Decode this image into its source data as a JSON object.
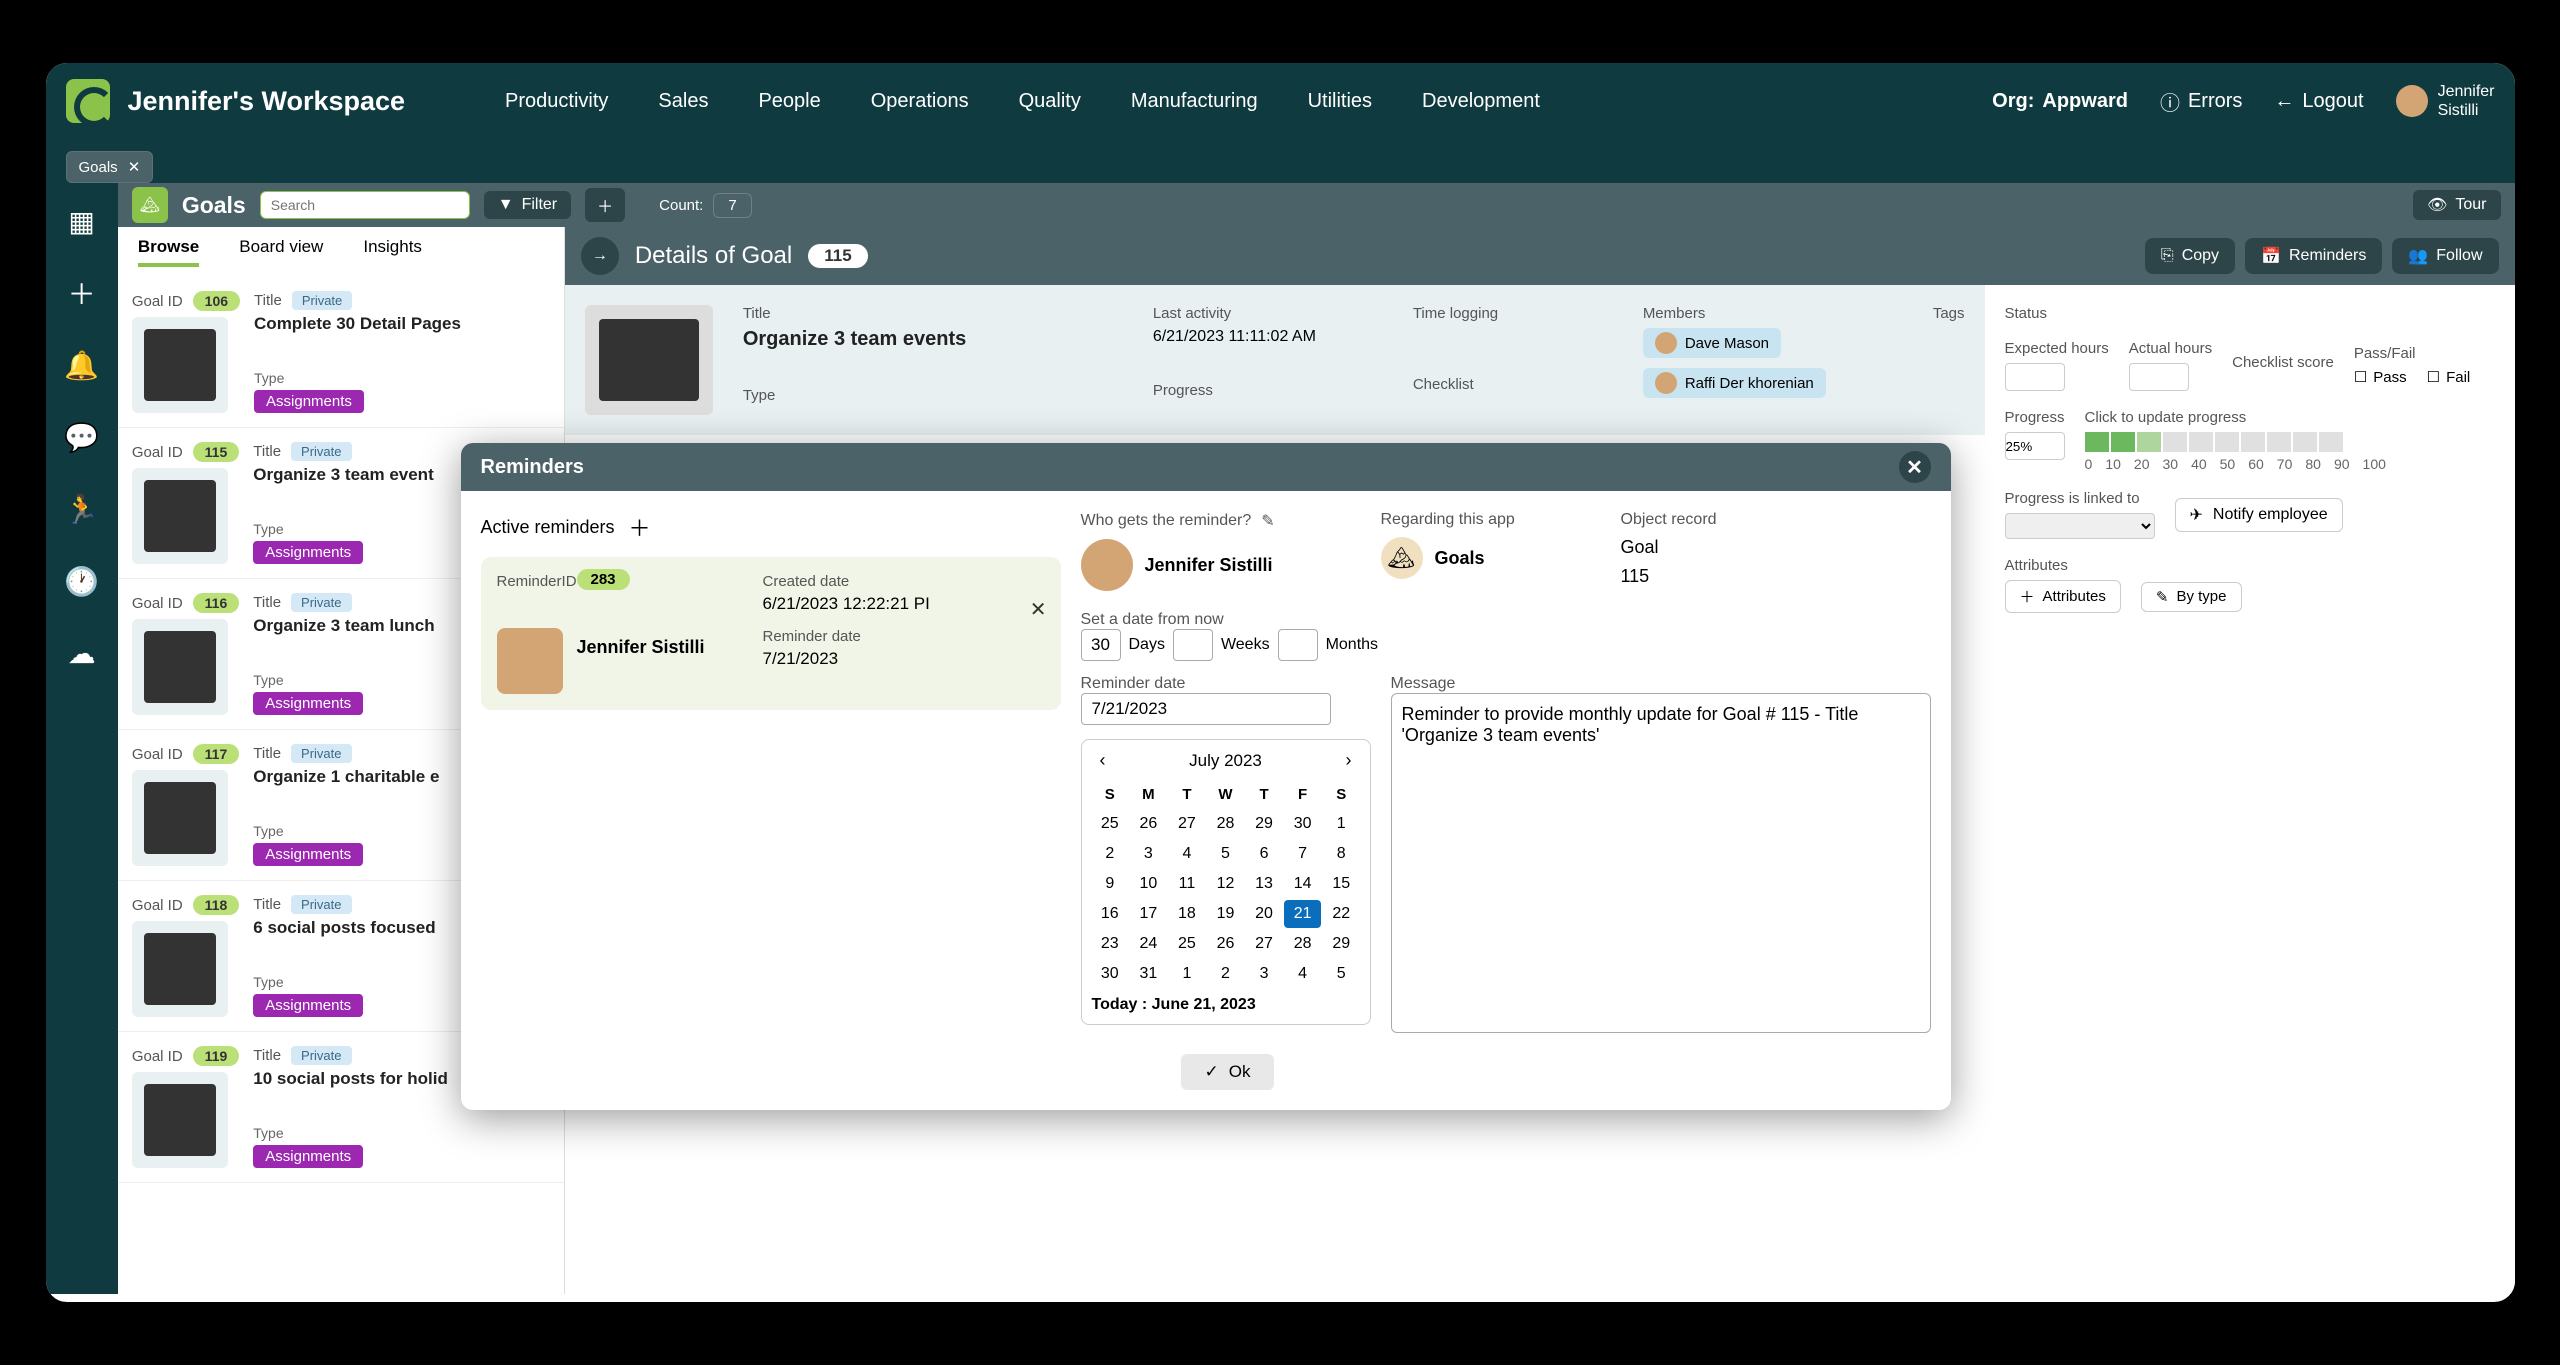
{
  "header": {
    "workspace": "Jennifer's Workspace",
    "nav": [
      "Productivity",
      "Sales",
      "People",
      "Operations",
      "Quality",
      "Manufacturing",
      "Utilities",
      "Development"
    ],
    "org_label": "Org:",
    "org_name": "Appward",
    "errors": "Errors",
    "logout": "Logout",
    "user_first": "Jennifer",
    "user_last": "Sistilli"
  },
  "tab": {
    "name": "Goals"
  },
  "page": {
    "title": "Goals",
    "search_placeholder": "Search",
    "filter": "Filter",
    "count_label": "Count:",
    "count": "7",
    "tour": "Tour"
  },
  "list_tabs": [
    "Browse",
    "Board view",
    "Insights"
  ],
  "goals": [
    {
      "id": "106",
      "title": "Complete 30 Detail Pages",
      "privacy": "Private",
      "type": "Assignments"
    },
    {
      "id": "115",
      "title": "Organize 3 team event",
      "privacy": "Private",
      "type": "Assignments"
    },
    {
      "id": "116",
      "title": "Organize 3 team lunch",
      "privacy": "Private",
      "type": "Assignments"
    },
    {
      "id": "117",
      "title": "Organize 1 charitable e",
      "privacy": "Private",
      "type": "Assignments"
    },
    {
      "id": "118",
      "title": "6 social posts focused",
      "privacy": "Private",
      "type": "Assignments"
    },
    {
      "id": "119",
      "title": "10 social posts for holid",
      "privacy": "Private",
      "type": "Assignments"
    }
  ],
  "labels": {
    "goal_id": "Goal ID",
    "title": "Title",
    "type": "Type"
  },
  "detail": {
    "header": "Details of Goal",
    "id": "115",
    "copy": "Copy",
    "reminders": "Reminders",
    "follow": "Follow",
    "title_label": "Title",
    "title": "Organize 3 team events",
    "last_activity_label": "Last activity",
    "last_activity": "6/21/2023 11:11:02 AM",
    "time_logging_label": "Time logging",
    "members_label": "Members",
    "members": [
      "Dave Mason",
      "Raffi Der khorenian"
    ],
    "tags_label": "Tags",
    "type_label": "Type",
    "progress_label": "Progress",
    "checklist_label": "Checklist"
  },
  "sidebar": {
    "status": "Status",
    "exp_hours": "Expected hours",
    "act_hours": "Actual hours",
    "check_score": "Checklist score",
    "passfail": "Pass/Fail",
    "pass": "Pass",
    "fail": "Fail",
    "progress": "Progress",
    "click_update": "Click to update progress",
    "progress_val": "25%",
    "prog_ticks": [
      "0",
      "10",
      "20",
      "30",
      "40",
      "50",
      "60",
      "70",
      "80",
      "90",
      "100"
    ],
    "linked": "Progress is linked to",
    "notify": "Notify employee",
    "attributes": "Attributes",
    "add_attr": "Attributes",
    "by_type": "By type"
  },
  "modal": {
    "title": "Reminders",
    "active": "Active reminders",
    "reminder_id_label": "ReminderID",
    "reminder_id": "283",
    "created_label": "Created date",
    "created": "6/21/2023 12:22:21 PI",
    "rdate_label": "Reminder date",
    "rdate": "7/21/2023",
    "sender": "Jennifer Sistilli",
    "who_label": "Who gets the reminder?",
    "who": "Jennifer Sistilli",
    "regarding_label": "Regarding this app",
    "regarding": "Goals",
    "object_label": "Object record",
    "object_type": "Goal",
    "object_id": "115",
    "set_date_label": "Set a date from now",
    "days": "30",
    "days_lbl": "Days",
    "weeks_lbl": "Weeks",
    "months_lbl": "Months",
    "rem_date_label": "Reminder date",
    "rem_date": "7/21/2023",
    "msg_label": "Message",
    "msg": "Reminder to provide monthly update for Goal # 115 - Title 'Organize 3 team events'",
    "ok": "Ok",
    "cal_month": "July 2023",
    "cal_dow": [
      "S",
      "M",
      "T",
      "W",
      "T",
      "F",
      "S"
    ],
    "cal_today": "Today : June 21, 2023"
  }
}
